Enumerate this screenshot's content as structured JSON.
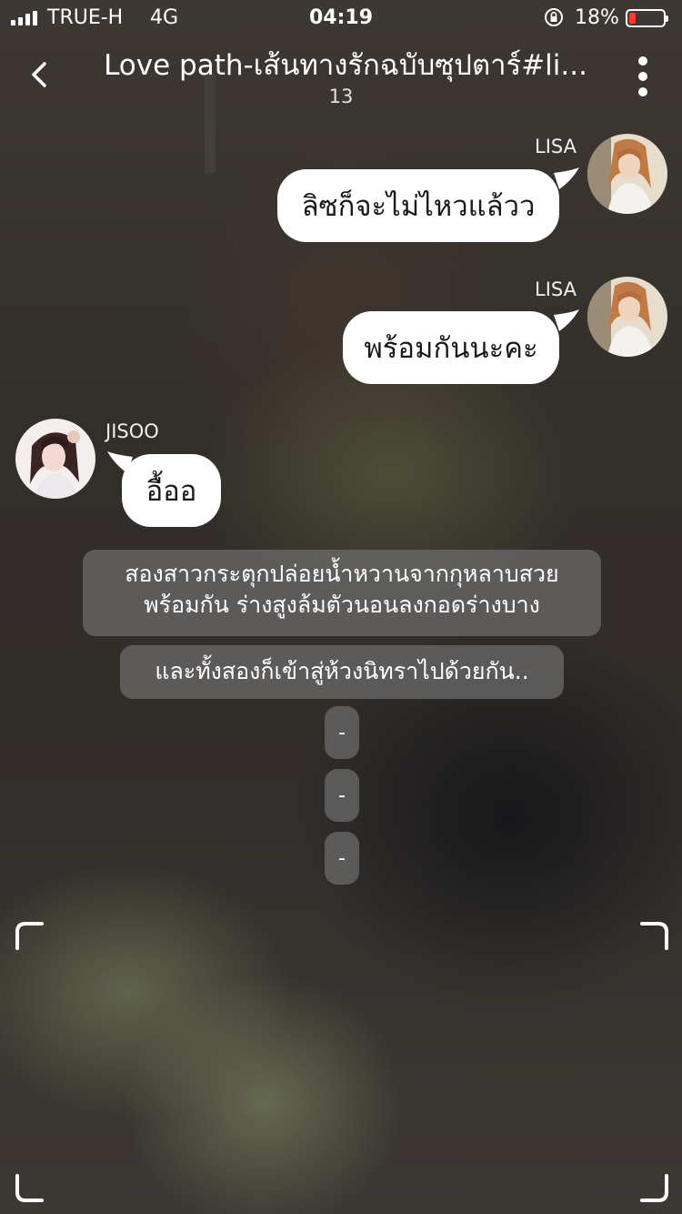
{
  "status_bar": {
    "carrier": "TRUE-H",
    "network": "4G",
    "time": "04:19",
    "battery_percent": "18%",
    "battery_level": 0.18,
    "battery_color": "#ff3b30"
  },
  "header": {
    "back_icon": "chevron-left-icon",
    "title": "Love path-เส้นทางรักฉบับซุปตาร์#li...",
    "count": "13",
    "more_icon": "more-vertical-icon"
  },
  "messages": [
    {
      "sender": "LISA",
      "side": "right",
      "text": "ลิซก็จะไม่ไหวแล้วว"
    },
    {
      "sender": "LISA",
      "side": "right",
      "text": "พร้อมกันนะคะ"
    },
    {
      "sender": "JISOO",
      "side": "left",
      "text": "อื้ออ"
    }
  ],
  "narration": [
    {
      "text": "สองสาวกระตุกปล่อยน้ำหวานจากกุหลาบสวย พร้อมกัน ร่างสูงล้มตัวนอนลงกอดร่างบาง"
    },
    {
      "text": "และทั้งสองก็เข้าสู่ห้วงนิทราไปด้วยกัน.."
    }
  ],
  "dashes": [
    "-",
    "-",
    "-"
  ],
  "corner_icon": "viewfinder-corner-icon"
}
